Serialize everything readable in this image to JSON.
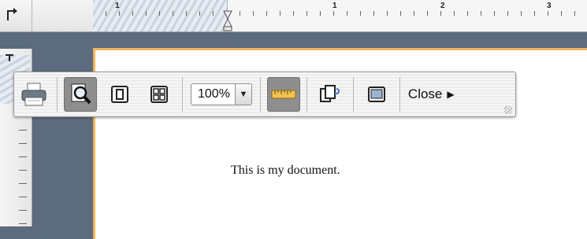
{
  "ruler": {
    "numbers": [
      "1",
      "1",
      "2",
      "3"
    ]
  },
  "document": {
    "text": "This is my document."
  },
  "toolbar": {
    "zoom_value": "100%",
    "close_label": "Close",
    "icons": [
      "printer-icon",
      "magnifier-icon",
      "single-page-icon",
      "four-pages-icon",
      "ruler-icon",
      "copy-pages-icon",
      "full-screen-icon"
    ],
    "active": [
      "magnifier",
      "ruler"
    ]
  },
  "colors": {
    "page_border": "#f2b65a",
    "desktop": "#5c6b7d"
  }
}
